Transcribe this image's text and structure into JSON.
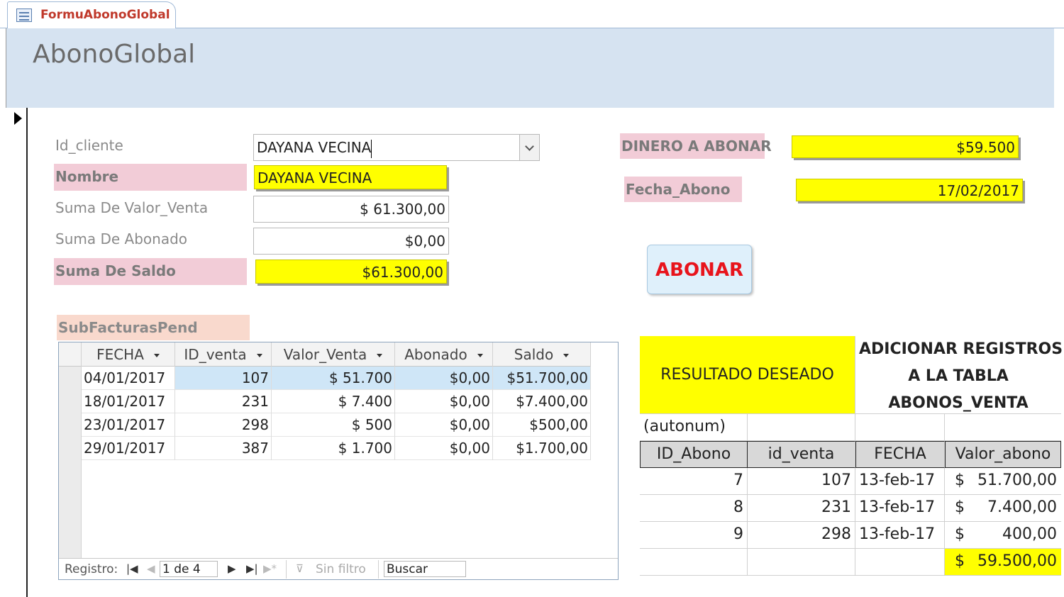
{
  "tab": {
    "label": "FormuAbonoGlobal",
    "icon": "form-icon"
  },
  "form": {
    "title": "AbonoGlobal"
  },
  "fields": {
    "id_cliente": {
      "label": "Id_cliente",
      "value": "DAYANA VECINA"
    },
    "nombre": {
      "label": "Nombre",
      "value": "DAYANA VECINA"
    },
    "suma_valor_venta": {
      "label": "Suma De Valor_Venta",
      "value": "$ 61.300,00"
    },
    "suma_abonado": {
      "label": "Suma De Abonado",
      "value": "$0,00"
    },
    "suma_saldo": {
      "label": "Suma De Saldo",
      "value": "$61.300,00"
    },
    "dinero_abonar": {
      "label": "DINERO A ABONAR",
      "value": "$59.500"
    },
    "fecha_abono": {
      "label": "Fecha_Abono",
      "value": "17/02/2017"
    }
  },
  "button_abonar": "ABONAR",
  "subform": {
    "label": "SubFacturasPend",
    "columns": [
      "FECHA",
      "ID_venta",
      "Valor_Venta",
      "Abonado",
      "Saldo"
    ],
    "rows": [
      [
        "04/01/2017",
        "107",
        "$ 51.700",
        "$0,00",
        "$51.700,00"
      ],
      [
        "18/01/2017",
        "231",
        "$ 7.400",
        "$0,00",
        "$7.400,00"
      ],
      [
        "23/01/2017",
        "298",
        "$ 500",
        "$0,00",
        "$500,00"
      ],
      [
        "29/01/2017",
        "387",
        "$ 1.700",
        "$0,00",
        "$1.700,00"
      ]
    ],
    "nav": {
      "label": "Registro:",
      "position": "1 de 4",
      "filter": "Sin filtro",
      "search": "Buscar"
    }
  },
  "sheet": {
    "result_label": "RESULTADO DESEADO",
    "add_title_lines": [
      "ADICIONAR REGISTROS",
      "A LA TABLA",
      "ABONOS_VENTA"
    ],
    "autonum": "(autonum)",
    "headers": [
      "ID_Abono",
      "id_venta",
      "FECHA",
      "Valor_abono"
    ],
    "rows": [
      [
        "7",
        "107",
        "13-feb-17",
        "$",
        "51.700,00"
      ],
      [
        "8",
        "231",
        "13-feb-17",
        "$",
        "7.400,00"
      ],
      [
        "9",
        "298",
        "13-feb-17",
        "$",
        "400,00"
      ]
    ],
    "total": {
      "currency": "$",
      "amount": "59.500,00"
    }
  },
  "colors": {
    "highlight": "#ffff00",
    "label_pink": "#f2ccd7",
    "accent_red": "#e8141c"
  }
}
